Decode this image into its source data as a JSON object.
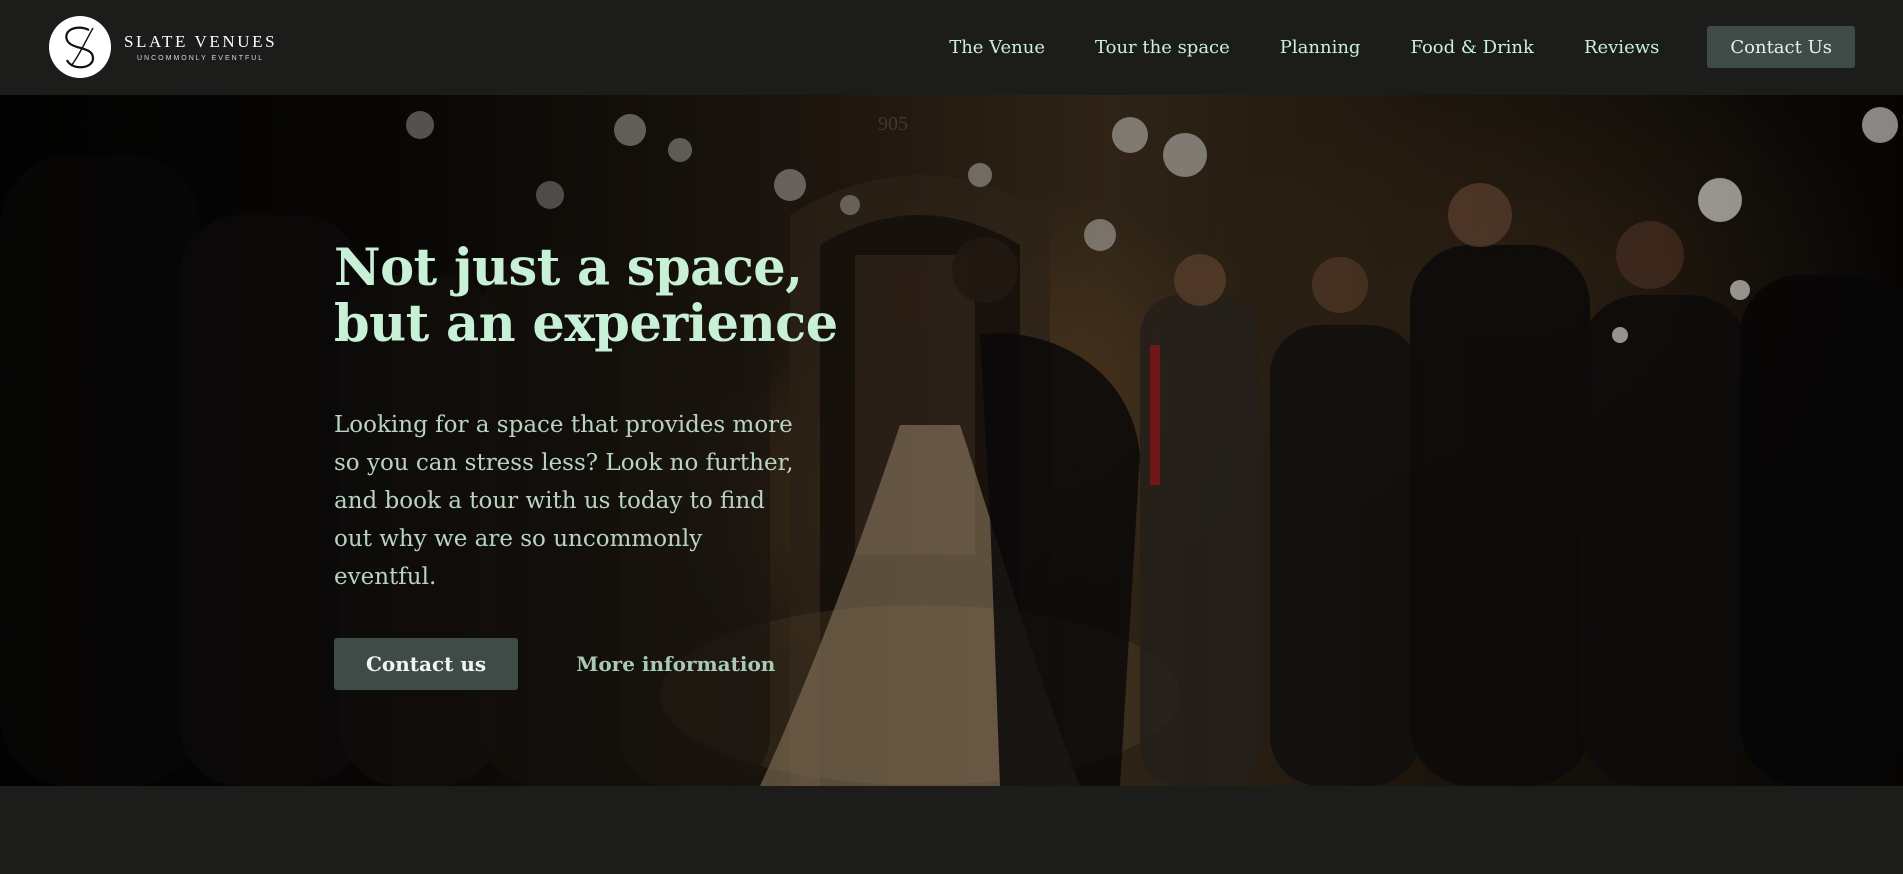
{
  "brand": {
    "name": "SLATE VENUES",
    "tagline": "UNCOMMONLY EVENTFUL",
    "logo_icon": "slate-s-monogram-icon"
  },
  "nav": {
    "items": [
      {
        "label": "The Venue"
      },
      {
        "label": "Tour the space"
      },
      {
        "label": "Planning"
      },
      {
        "label": "Food & Drink"
      },
      {
        "label": "Reviews"
      }
    ],
    "cta_label": "Contact Us"
  },
  "hero": {
    "title": "Not just a space,\nbut an experience",
    "text": "Looking for a space that provides more so you can stress less? Look no further, and book a tour with us today to find out why we are so uncommonly eventful.",
    "primary_button": "Contact us",
    "secondary_link": "More information",
    "background_image": "wedding couple kissing under sparklers held by guests",
    "door_number": "905"
  },
  "colors": {
    "header_bg": "#1c1c1b",
    "accent_text": "#c8f0d6",
    "button_bg": "#3e4b47"
  }
}
